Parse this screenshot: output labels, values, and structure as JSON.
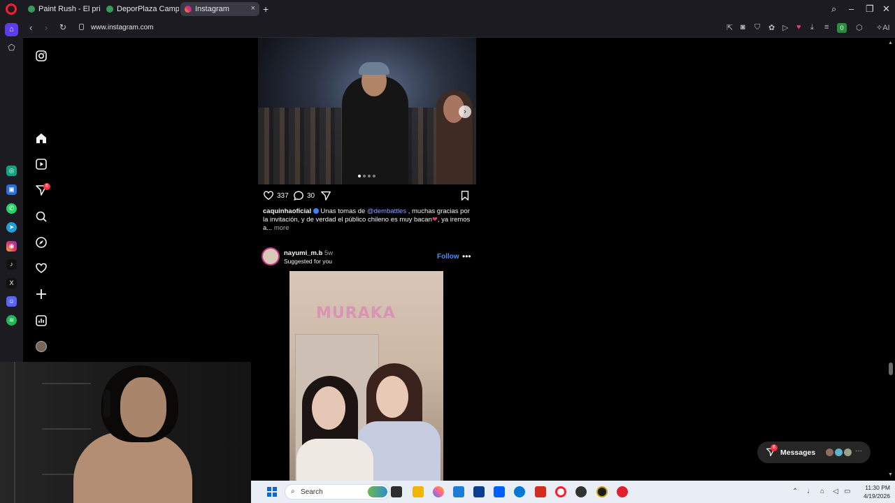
{
  "browser": {
    "tabs": [
      {
        "title": "Paint Rush - El primer spl",
        "active": false
      },
      {
        "title": "DeporPlaza Campo de M",
        "active": false
      },
      {
        "title": "Instagram",
        "active": true
      }
    ],
    "tab_close": "×",
    "new_tab": "+",
    "url": "www.instagram.com",
    "ai_label": "AI",
    "ext_badge": "0"
  },
  "instagram": {
    "notifications_badge": "6",
    "post1": {
      "likes": "337",
      "comments": "30",
      "username": "caquinhaoficial",
      "caption_before": " Unas tomas de ",
      "mention": "@dembattles",
      "caption_after": " , muchas gracias por la invitación, y de verdad el público chileno es muy bacan",
      "caption_tail": ", ya iremos a...",
      "more": "more",
      "emoji": "❤"
    },
    "post2": {
      "username": "nayumi_m.b",
      "time": "• 5w",
      "subtitle": "Suggested for you",
      "follow": "Follow",
      "options": "•••",
      "sign_text": "MURAKA"
    },
    "messages": {
      "label": "Messages",
      "badge": "6",
      "more": "···"
    }
  },
  "taskbar": {
    "search_placeholder": "Search",
    "time": "11:30 PM",
    "date": "4/19/2026"
  },
  "colors": {
    "accent_blue": "#4a8cff",
    "badge_red": "#ff3040",
    "opera_red": "#ff1b2d",
    "opera_home": "#5b3cf0"
  }
}
